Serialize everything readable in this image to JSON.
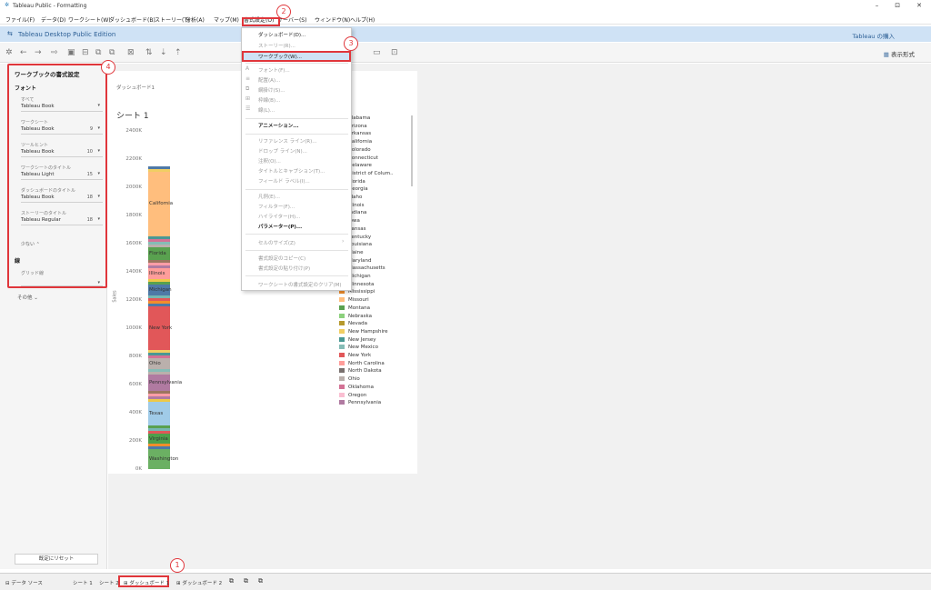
{
  "window": {
    "title": "Tableau Public - Formatting",
    "controls": [
      "–",
      "⊡",
      "✕"
    ]
  },
  "menubar": [
    "ファイル(F)",
    "データ(D)",
    "ワークシート(W)",
    "ダッシュボード(B)",
    "ストーリー(T)",
    "分析(A)",
    "マップ(M)",
    "書式設定(O)",
    "サーバー(S)",
    "ウィンドウ(N)",
    "ヘルプ(H)"
  ],
  "promo": {
    "left": "Tableau Desktop Public Edition",
    "right": "Tableau の購入"
  },
  "toolbar": {
    "show_me": "表示形式"
  },
  "format_pane": {
    "title": "ワークブックの書式設定",
    "fonts_header": "フォント",
    "rows": [
      {
        "label": "すべて",
        "value": "Tableau Book",
        "size": ""
      },
      {
        "label": "ワークシート",
        "value": "Tableau Book",
        "size": "9"
      },
      {
        "label": "ツールヒント",
        "value": "Tableau Book",
        "size": "10"
      },
      {
        "label": "ワークシートのタイトル",
        "value": "Tableau Light",
        "size": "15"
      },
      {
        "label": "ダッシュボードのタイトル",
        "value": "Tableau Book",
        "size": "18"
      },
      {
        "label": "ストーリーのタイトル",
        "value": "Tableau Regular",
        "size": "18"
      }
    ],
    "less": "少ない ⌃",
    "lines_header": "線",
    "grid_lines": "グリッド線",
    "other": "その他 ⌄",
    "reset": "既定にリセット"
  },
  "dashboard": {
    "dash_title": "ダッシュボード1",
    "sheet_title": "シート 1",
    "y_axis_label": "Sales"
  },
  "chart_data": {
    "type": "bar",
    "ylabel": "Sales",
    "ylim": [
      0,
      2400000
    ],
    "y_ticks": [
      "0K",
      "200K",
      "400K",
      "600K",
      "800K",
      "1000K",
      "1200K",
      "1400K",
      "1600K",
      "1800K",
      "2000K",
      "2200K",
      "2400K"
    ],
    "segment_labels": [
      "California",
      "Florida",
      "Illinois",
      "Michigan",
      "New York",
      "Ohio",
      "Pennsylvania",
      "Texas",
      "Virginia",
      "Washington"
    ],
    "series": [
      {
        "name": "Washington",
        "value": 140000,
        "color": "#6bb063"
      },
      {
        "name": "Virginia",
        "value": 70000,
        "color": "#4e9f4b"
      },
      {
        "name": "Texas",
        "value": 170000,
        "color": "#a0cbe8"
      },
      {
        "name": "Pennsylvania",
        "value": 115000,
        "color": "#b07aa1"
      },
      {
        "name": "Ohio",
        "value": 80000,
        "color": "#bab0ac"
      },
      {
        "name": "New York",
        "value": 310000,
        "color": "#e15759"
      },
      {
        "name": "Michigan",
        "value": 76000,
        "color": "#4e79a7"
      },
      {
        "name": "Illinois",
        "value": 80000,
        "color": "#ff9d9a"
      },
      {
        "name": "Florida",
        "value": 90000,
        "color": "#59a14f"
      },
      {
        "name": "California",
        "value": 457000,
        "color": "#ffbe7d"
      }
    ]
  },
  "legend": [
    {
      "name": "Alabama",
      "color": ""
    },
    {
      "name": "Arizona",
      "color": ""
    },
    {
      "name": "Arkansas",
      "color": ""
    },
    {
      "name": "California",
      "color": ""
    },
    {
      "name": "Colorado",
      "color": ""
    },
    {
      "name": "Connecticut",
      "color": ""
    },
    {
      "name": "Delaware",
      "color": ""
    },
    {
      "name": "District of Colum..",
      "color": ""
    },
    {
      "name": "Florida",
      "color": ""
    },
    {
      "name": "Georgia",
      "color": ""
    },
    {
      "name": "Idaho",
      "color": ""
    },
    {
      "name": "Illinois",
      "color": ""
    },
    {
      "name": "Indiana",
      "color": ""
    },
    {
      "name": "Iowa",
      "color": ""
    },
    {
      "name": "Kansas",
      "color": ""
    },
    {
      "name": "Kentucky",
      "color": ""
    },
    {
      "name": "Louisiana",
      "color": ""
    },
    {
      "name": "Maine",
      "color": ""
    },
    {
      "name": "Maryland",
      "color": "#4e79a7"
    },
    {
      "name": "Massachusetts",
      "color": "#d4a6c8"
    },
    {
      "name": "Michigan",
      "color": "#4e79a7"
    },
    {
      "name": "Minnesota",
      "color": "#a0cbe8"
    },
    {
      "name": "Mississippi",
      "color": "#f28e2b"
    },
    {
      "name": "Missouri",
      "color": "#ffbe7d"
    },
    {
      "name": "Montana",
      "color": "#59a14f"
    },
    {
      "name": "Nebraska",
      "color": "#8cd17d"
    },
    {
      "name": "Nevada",
      "color": "#b6992d"
    },
    {
      "name": "New Hampshire",
      "color": "#f1ce63"
    },
    {
      "name": "New Jersey",
      "color": "#499894"
    },
    {
      "name": "New Mexico",
      "color": "#86bcb6"
    },
    {
      "name": "New York",
      "color": "#e15759"
    },
    {
      "name": "North Carolina",
      "color": "#ff9d9a"
    },
    {
      "name": "North Dakota",
      "color": "#79706e"
    },
    {
      "name": "Ohio",
      "color": "#bab0ac"
    },
    {
      "name": "Oklahoma",
      "color": "#d37295"
    },
    {
      "name": "Oregon",
      "color": "#fabfd2"
    },
    {
      "name": "Pennsylvania",
      "color": "#b07aa1"
    }
  ],
  "format_menu": [
    {
      "label": "ダッシュボード(D)...",
      "state": "enabled",
      "icon": ""
    },
    {
      "label": "ストーリー(R)...",
      "state": "disabled",
      "icon": ""
    },
    {
      "label": "ワークブック(W)...",
      "state": "highlight",
      "icon": ""
    },
    {
      "label": "フォント(F)...",
      "state": "disabled",
      "icon": "A"
    },
    {
      "label": "配置(A)...",
      "state": "disabled",
      "icon": "≡"
    },
    {
      "label": "網掛け(S)...",
      "state": "disabled",
      "icon": "⧉"
    },
    {
      "label": "枠線(B)...",
      "state": "disabled",
      "icon": "⊞"
    },
    {
      "label": "線(L)...",
      "state": "disabled",
      "icon": "☰"
    },
    {
      "label": "アニメーション...",
      "state": "bold",
      "icon": ""
    },
    {
      "label": "リファレンス ライン(R)...",
      "state": "disabled",
      "icon": ""
    },
    {
      "label": "ドロップ ライン(N)...",
      "state": "disabled",
      "icon": ""
    },
    {
      "label": "注釈(O)...",
      "state": "disabled",
      "icon": ""
    },
    {
      "label": "タイトルとキャプション(T)...",
      "state": "disabled",
      "icon": ""
    },
    {
      "label": "フィールド ラベル(I)...",
      "state": "disabled",
      "icon": ""
    },
    {
      "label": "凡例(E)...",
      "state": "disabled",
      "icon": ""
    },
    {
      "label": "フィルター(F)...",
      "state": "disabled",
      "icon": ""
    },
    {
      "label": "ハイライター(H)...",
      "state": "disabled",
      "icon": ""
    },
    {
      "label": "パラメーター(P)...",
      "state": "bold",
      "icon": ""
    },
    {
      "label": "セルのサイズ(Z)",
      "state": "disabled",
      "icon": ""
    },
    {
      "label": "書式設定のコピー(C)",
      "state": "disabled",
      "icon": ""
    },
    {
      "label": "書式設定の貼り付け(P)",
      "state": "disabled",
      "icon": ""
    },
    {
      "label": "ワークシートの書式設定のクリア(M)",
      "state": "disabled",
      "icon": ""
    }
  ],
  "tabs": [
    "データ ソース",
    "シート 1",
    "シート 2",
    "ダッシュボード 1",
    "ダッシュボード 2"
  ],
  "badges": [
    "1",
    "2",
    "3",
    "4"
  ],
  "accent": "#e0363b"
}
